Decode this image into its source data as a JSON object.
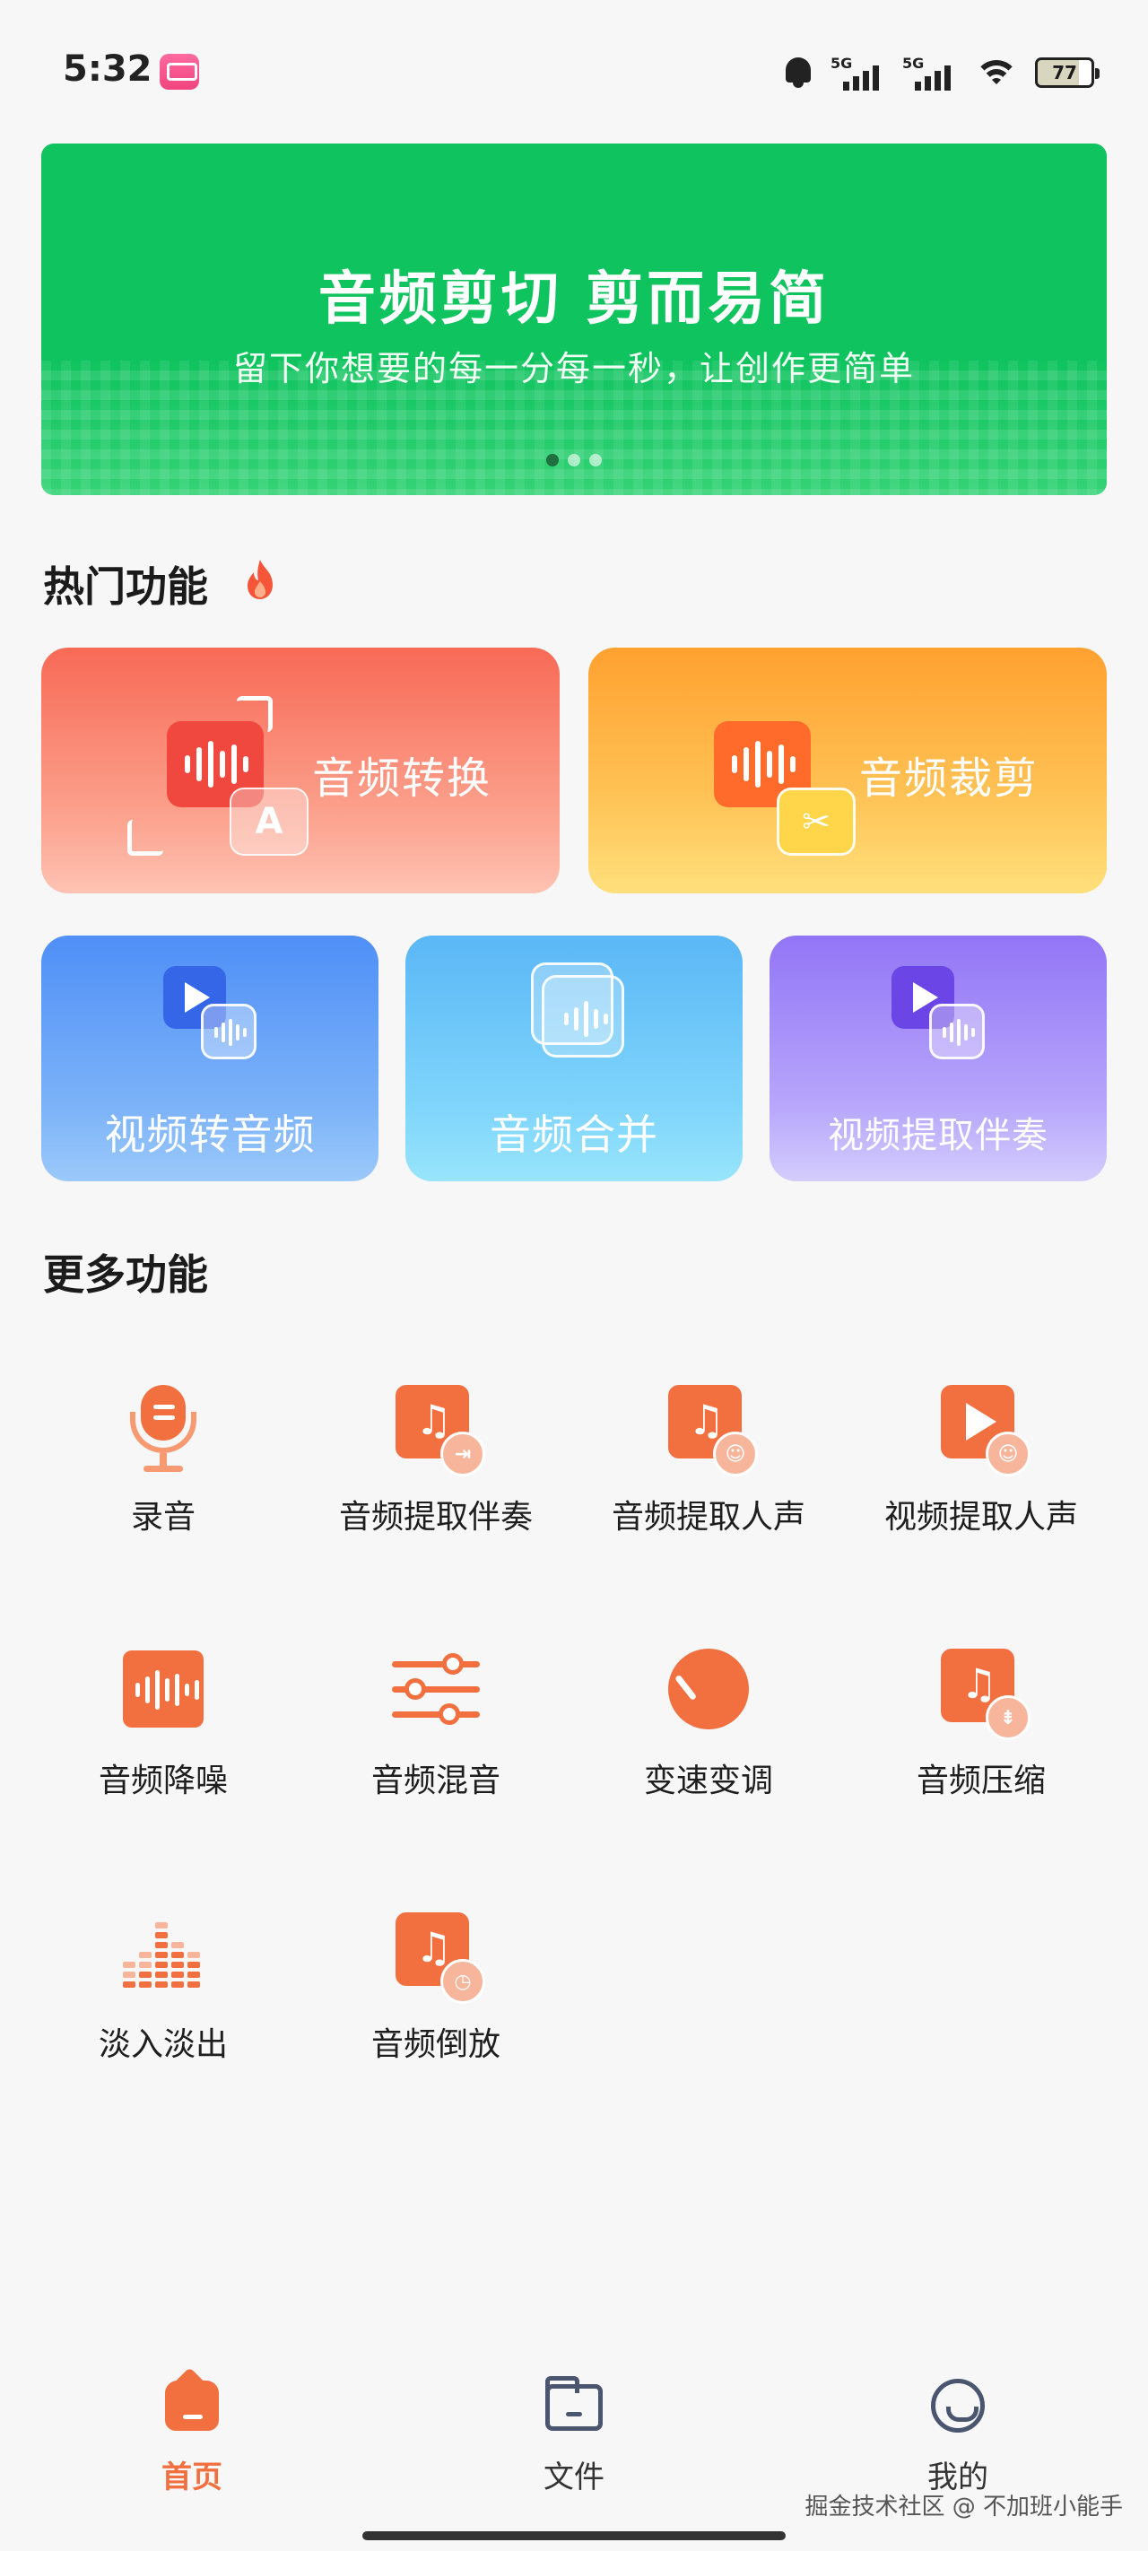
{
  "status_bar": {
    "time": "5:32",
    "network_1": "5G",
    "network_2": "5G",
    "battery": "77",
    "icons": [
      "bilibili-app-icon",
      "bell-icon",
      "signal-icon",
      "signal-icon",
      "wifi-icon",
      "battery-icon"
    ]
  },
  "banner": {
    "title": "音频剪切 剪而易简",
    "subtitle": "留下你想要的每一分每一秒，让创作更简单",
    "page_count": 3,
    "active_page": 1,
    "color": "#0fc35f"
  },
  "hot": {
    "title": "热门功能",
    "icon": "flame-icon",
    "big_cards": [
      {
        "label": "音频转换",
        "icon": "audio-convert-icon"
      },
      {
        "label": "音频裁剪",
        "icon": "audio-cut-icon"
      }
    ],
    "small_cards": [
      {
        "label": "视频转音频",
        "icon": "video-to-audio-icon"
      },
      {
        "label": "音频合并",
        "icon": "audio-merge-icon"
      },
      {
        "label": "视频提取伴奏",
        "icon": "video-extract-accompaniment-icon"
      }
    ]
  },
  "more": {
    "title": "更多功能",
    "items": [
      {
        "label": "录音",
        "icon": "microphone-icon"
      },
      {
        "label": "音频提取伴奏",
        "icon": "audio-extract-accompaniment-icon"
      },
      {
        "label": "音频提取人声",
        "icon": "audio-extract-vocals-icon"
      },
      {
        "label": "视频提取人声",
        "icon": "video-extract-vocals-icon"
      },
      {
        "label": "音频降噪",
        "icon": "audio-denoise-icon"
      },
      {
        "label": "音频混音",
        "icon": "audio-mix-icon"
      },
      {
        "label": "变速变调",
        "icon": "speed-pitch-icon"
      },
      {
        "label": "音频压缩",
        "icon": "audio-compress-icon"
      },
      {
        "label": "淡入淡出",
        "icon": "fade-in-out-icon"
      },
      {
        "label": "音频倒放",
        "icon": "audio-reverse-icon"
      }
    ]
  },
  "bottom_nav": {
    "items": [
      {
        "label": "首页",
        "icon": "home-icon",
        "active": true
      },
      {
        "label": "文件",
        "icon": "folder-icon",
        "active": false
      },
      {
        "label": "我的",
        "icon": "smiley-profile-icon",
        "active": false
      }
    ]
  },
  "watermark": "掘金技术社区 @ 不加班小能手",
  "accent_color": "#f2703f"
}
